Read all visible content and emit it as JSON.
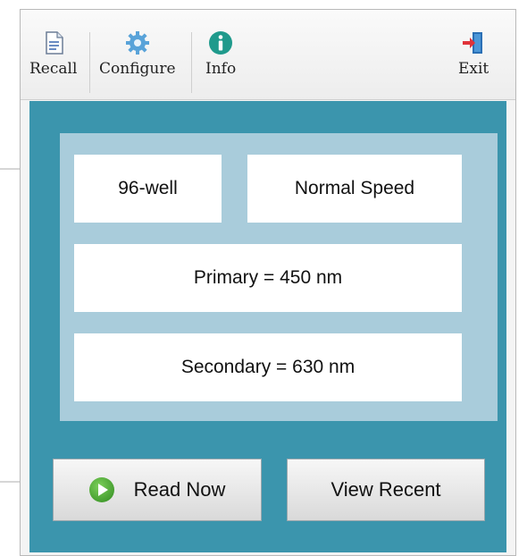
{
  "toolbar": {
    "recall": {
      "label": "Recall",
      "icon": "document-icon"
    },
    "configure": {
      "label": "Configure",
      "icon": "gear-icon"
    },
    "info": {
      "label": "Info",
      "icon": "info-icon"
    },
    "exit": {
      "label": "Exit",
      "icon": "exit-door-icon"
    }
  },
  "settings": {
    "plate_format": "96-well",
    "speed": "Normal Speed",
    "primary": "Primary = 450 nm",
    "secondary": "Secondary = 630 nm"
  },
  "actions": {
    "read_now": "Read Now",
    "view_recent": "View Recent"
  },
  "colors": {
    "panel_background": "#3b95ad",
    "card_background": "#a9ccdb",
    "play_icon": "#3f9a2a"
  }
}
